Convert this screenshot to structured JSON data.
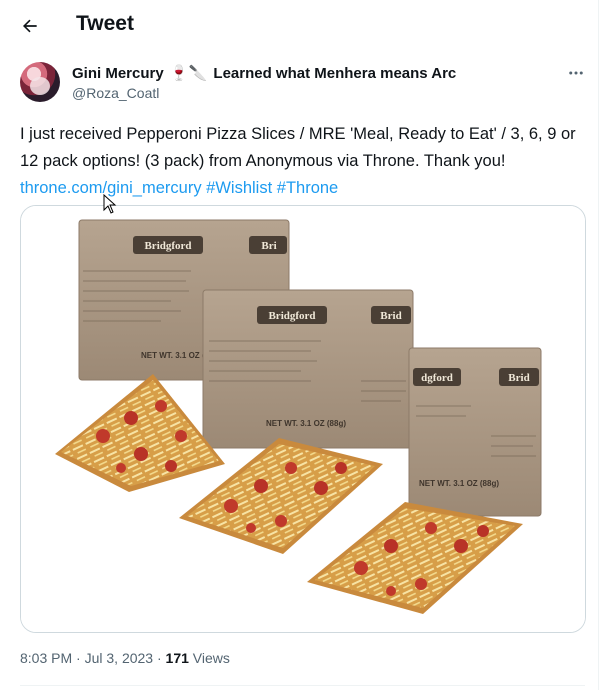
{
  "header": {
    "title": "Tweet"
  },
  "author": {
    "name": "Gini Mercury",
    "emojis": "🍷🔪",
    "name_suffix": "Learned what Menhera means Arc",
    "handle": "@Roza_Coatl"
  },
  "tweet": {
    "text": "I just received Pepperoni Pizza Slices / MRE 'Meal, Ready to Eat' / 3, 6, 9 or 12 pack options! (3 pack) from Anonymous via Throne. Thank you!",
    "links": [
      "throne.com/gini_mercury",
      "#Wishlist",
      "#Throne"
    ]
  },
  "media": {
    "package_brand": "Bridgford",
    "package_net_wt": "NET WT. 3.1 OZ (88g)"
  },
  "meta": {
    "time": "8:03 PM",
    "separator": "·",
    "date": "Jul 3, 2023",
    "views_count": "171",
    "views_label": "Views"
  },
  "colors": {
    "link": "#1d9bf0",
    "secondary_text": "#536471",
    "border": "#cfd9de"
  },
  "icons": {
    "back": "arrow-left-icon",
    "more": "more-horizontal-icon",
    "cursor": "mouse-pointer-icon"
  }
}
